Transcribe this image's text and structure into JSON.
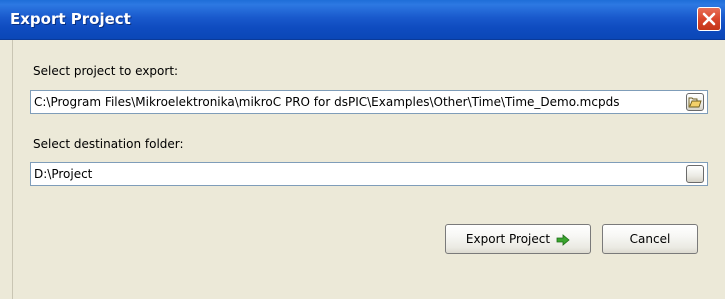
{
  "window": {
    "title": "Export Project",
    "close_icon": "close-icon"
  },
  "project": {
    "label": "Select project to export:",
    "value": "C:\\Program Files\\Mikroelektronika\\mikroC PRO for dsPIC\\Examples\\Other\\Time\\Time_Demo.mcpds",
    "browse_icon": "folder-open-icon"
  },
  "destination": {
    "label": "Select destination folder:",
    "value": "D:\\Project",
    "browse_icon": "checkbox-icon"
  },
  "buttons": {
    "export_label": "Export Project",
    "export_icon": "green-arrow-right-icon",
    "cancel_label": "Cancel"
  },
  "colors": {
    "titlebar": "#0b47b7",
    "dialog_bg": "#ece9d8",
    "close_button": "#d9462c",
    "export_arrow": "#3aa52e"
  }
}
